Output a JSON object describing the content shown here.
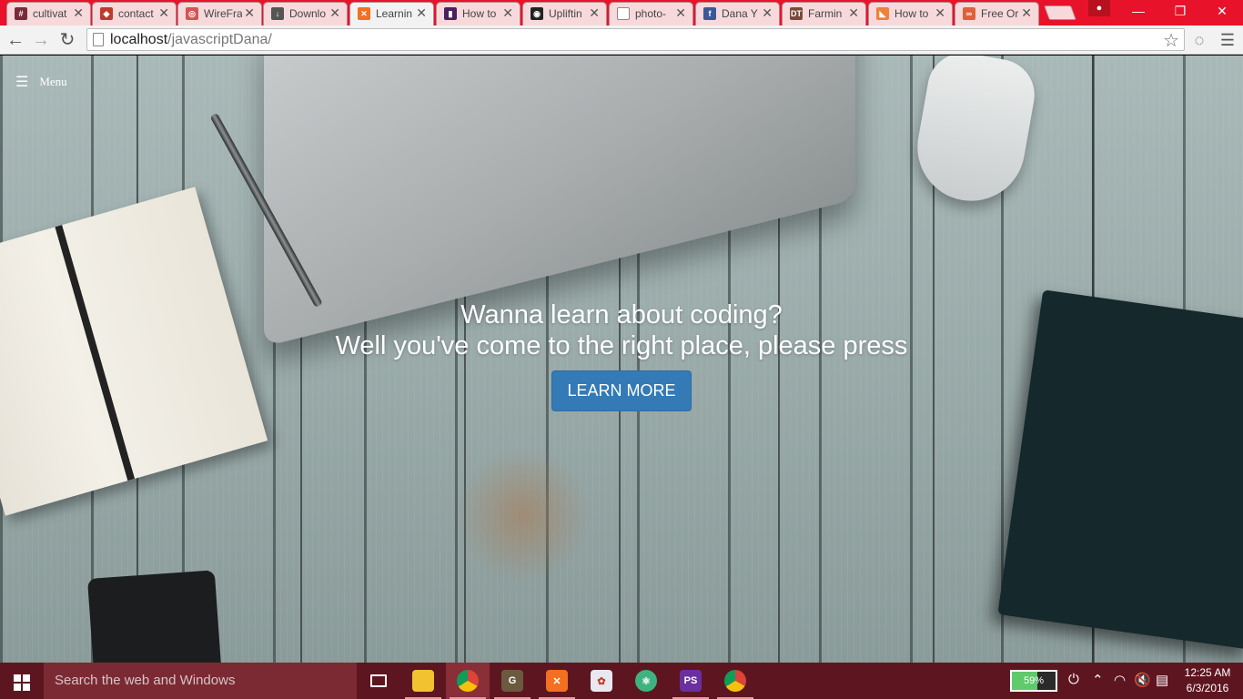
{
  "browser": {
    "tabs": [
      {
        "label": "cultivat",
        "favicon": "hash-icon",
        "color": "#7a2a3a"
      },
      {
        "label": "contact",
        "favicon": "shield-icon",
        "color": "#c0392b"
      },
      {
        "label": "WireFra",
        "favicon": "wireframe-icon",
        "color": "#d35454"
      },
      {
        "label": "Downlo",
        "favicon": "download-icon",
        "color": "#555555"
      },
      {
        "label": "Learnin",
        "favicon": "xampp-icon",
        "color": "#f36f21",
        "active": true
      },
      {
        "label": "How to",
        "favicon": "trello-icon",
        "color": "#4a2060"
      },
      {
        "label": "Upliftin",
        "favicon": "camera-icon",
        "color": "#222222"
      },
      {
        "label": "photo-",
        "favicon": "page-icon",
        "color": "#888888"
      },
      {
        "label": "Dana Y",
        "favicon": "facebook-icon",
        "color": "#3b5998"
      },
      {
        "label": "Farmin",
        "favicon": "dt-icon",
        "color": "#7a4a3a"
      },
      {
        "label": "How to",
        "favicon": "orange-icon",
        "color": "#f0803a"
      },
      {
        "label": "Free Or",
        "favicon": "swirl-icon",
        "color": "#e0603a"
      }
    ],
    "address": {
      "host": "localhost",
      "path": "/javascriptDana/"
    }
  },
  "page": {
    "menu_label": "Menu",
    "hero_line1": "Wanna learn about coding?",
    "hero_line2": "Well you've come to the right place, please press",
    "cta_label": "LEARN MORE",
    "accent": "#337ab7"
  },
  "taskbar": {
    "search_placeholder": "Search the web and Windows",
    "apps": [
      {
        "name": "task-view-icon"
      },
      {
        "name": "file-explorer-icon"
      },
      {
        "name": "chrome-icon",
        "active": true
      },
      {
        "name": "gimp-icon"
      },
      {
        "name": "xampp-icon"
      },
      {
        "name": "paint-icon"
      },
      {
        "name": "atom-icon"
      },
      {
        "name": "phpstorm-icon"
      },
      {
        "name": "chrome-icon-2"
      }
    ],
    "battery_percent": "59%",
    "battery_level": 0.59,
    "time": "12:25 AM",
    "date": "6/3/2016"
  }
}
